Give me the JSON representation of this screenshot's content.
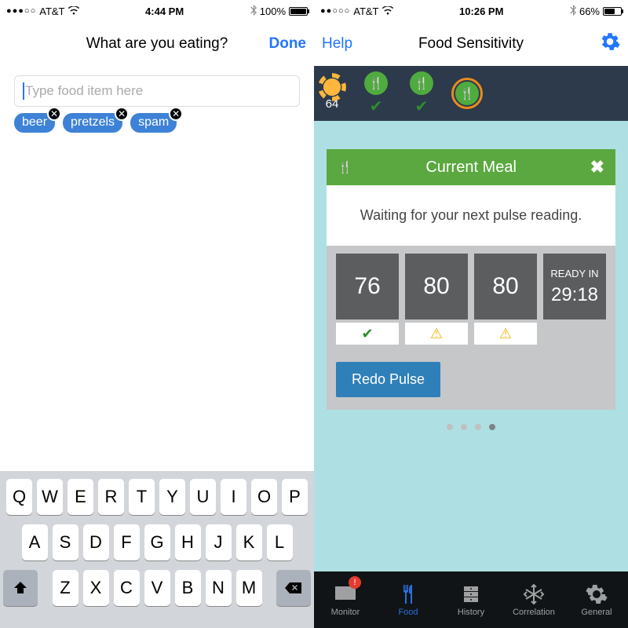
{
  "left_screen": {
    "status": {
      "carrier": "AT&T",
      "time": "4:44 PM",
      "battery_pct": "100%",
      "signal": "●●●○○"
    },
    "nav": {
      "title": "What are you eating?",
      "done": "Done"
    },
    "input": {
      "placeholder": "Type food item here"
    },
    "chips": [
      "beer",
      "pretzels",
      "spam"
    ],
    "keyboard": {
      "row1": [
        "Q",
        "W",
        "E",
        "R",
        "T",
        "Y",
        "U",
        "I",
        "O",
        "P"
      ],
      "row2": [
        "A",
        "S",
        "D",
        "F",
        "G",
        "H",
        "J",
        "K",
        "L"
      ],
      "row3": [
        "Z",
        "X",
        "C",
        "V",
        "B",
        "N",
        "M"
      ]
    }
  },
  "right_screen": {
    "status": {
      "carrier": "AT&T",
      "time": "10:26 PM",
      "battery_pct": "66%",
      "signal": "●●○○○"
    },
    "nav": {
      "help": "Help",
      "title": "Food Sensitivity"
    },
    "wake_value": "64",
    "card": {
      "title": "Current Meal",
      "message": "Waiting for your next pulse reading.",
      "pulses": [
        "76",
        "80",
        "80"
      ],
      "ready_label": "READY IN",
      "ready_time": "29:18",
      "redo": "Redo Pulse"
    },
    "tabs": {
      "monitor": "Monitor",
      "food": "Food",
      "history": "History",
      "correlation": "Correlation",
      "general": "General",
      "badge": "!"
    }
  }
}
